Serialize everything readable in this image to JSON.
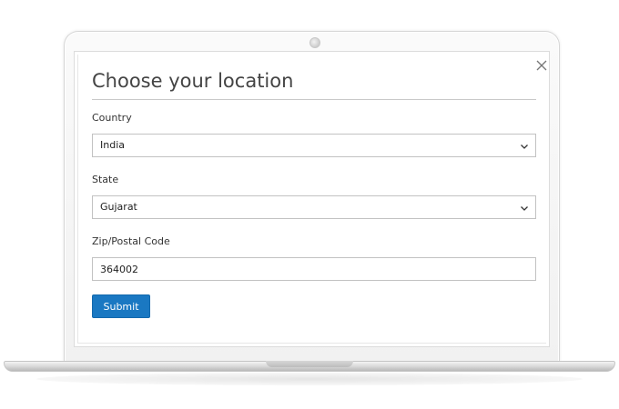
{
  "modal": {
    "title": "Choose your location",
    "close_icon": "close-icon"
  },
  "form": {
    "country": {
      "label": "Country",
      "selected": "India"
    },
    "state": {
      "label": "State",
      "selected": "Gujarat"
    },
    "zip": {
      "label": "Zip/Postal Code",
      "value": "364002"
    },
    "submit_label": "Submit"
  },
  "colors": {
    "accent": "#1a78c2",
    "title_text": "#444444",
    "border": "#c2c2c2"
  }
}
